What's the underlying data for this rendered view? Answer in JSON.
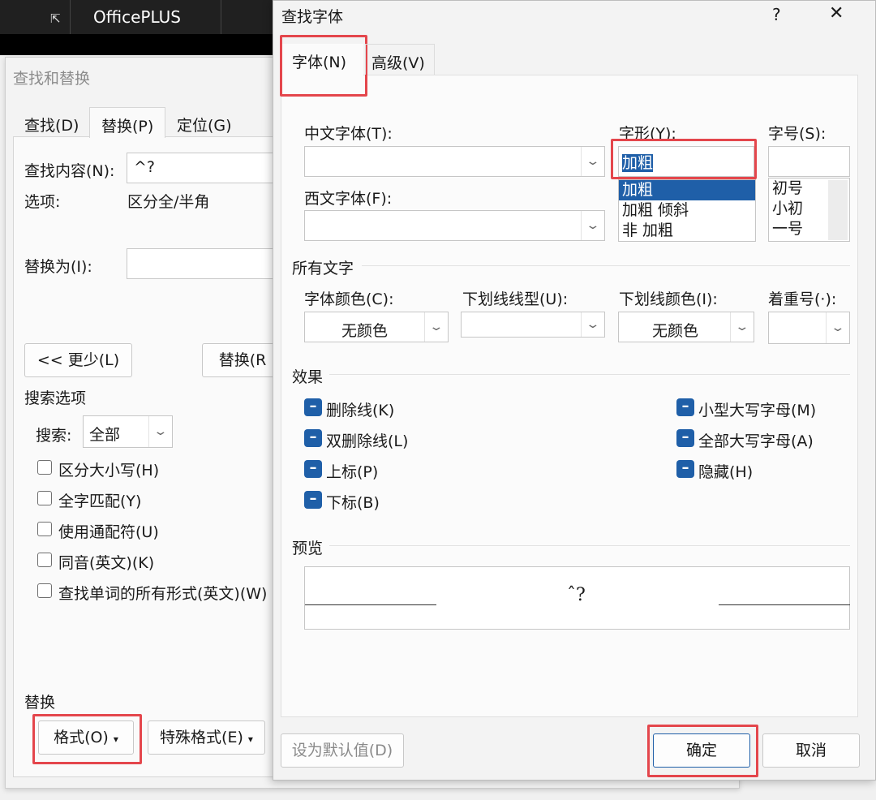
{
  "appbar": {
    "title": "OfficePLUS",
    "icon": "resize-icon"
  },
  "find_replace": {
    "title": "查找和替换",
    "tabs": [
      "查找(D)",
      "替换(P)",
      "定位(G)"
    ],
    "find_label": "查找内容(N):",
    "find_value": "^?",
    "options_label": "选项:",
    "options_value": "区分全/半角",
    "replace_label": "替换为(I):",
    "replace_value": "",
    "less_button": "<< 更少(L)",
    "replace_button": "替换(R",
    "search_options_heading": "搜索选项",
    "search_label": "搜索:",
    "search_value": "全部",
    "checkboxes": [
      "区分大小写(H)",
      "全字匹配(Y)",
      "使用通配符(U)",
      "同音(英文)(K)",
      "查找单词的所有形式(英文)(W)"
    ],
    "replace_heading": "替换",
    "format_button": "格式(O)",
    "special_button": "特殊格式(E)"
  },
  "font_dialog": {
    "title": "查找字体",
    "help": "?",
    "close": "✕",
    "tabs": [
      "字体(N)",
      "高级(V)"
    ],
    "chinese_font_label": "中文字体(T):",
    "western_font_label": "西文字体(F):",
    "style_label": "字形(Y):",
    "style_value": "加粗",
    "style_options": [
      "加粗",
      "加粗 倾斜",
      "非 加粗"
    ],
    "size_label": "字号(S):",
    "size_value": "",
    "size_options": [
      "初号",
      "小初",
      "一号"
    ],
    "all_text_heading": "所有文字",
    "font_color_label": "字体颜色(C):",
    "font_color_value": "无颜色",
    "underline_type_label": "下划线线型(U):",
    "underline_color_label": "下划线颜色(I):",
    "underline_color_value": "无颜色",
    "emphasis_label": "着重号(·):",
    "effects_heading": "效果",
    "effects_left": [
      "删除线(K)",
      "双删除线(L)",
      "上标(P)",
      "下标(B)"
    ],
    "effects_right": [
      "小型大写字母(M)",
      "全部大写字母(A)",
      "隐藏(H)"
    ],
    "preview_heading": "预览",
    "preview_text": "ˆ?",
    "default_button": "设为默认值(D)",
    "ok_button": "确定",
    "cancel_button": "取消"
  },
  "colors": {
    "highlight_red": "#e4464c",
    "selection_blue": "#1f5fa8"
  }
}
